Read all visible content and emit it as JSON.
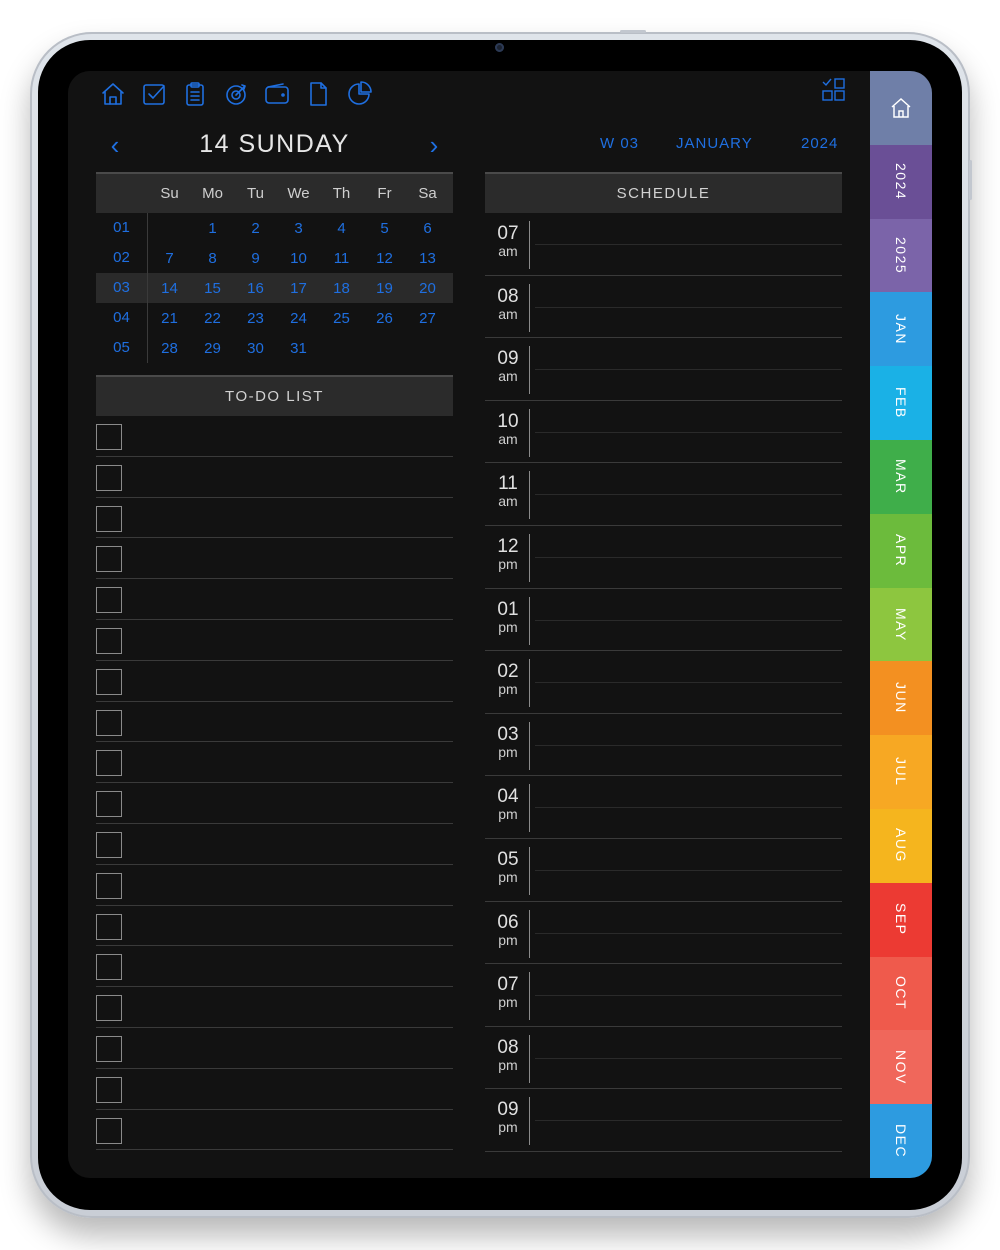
{
  "toolbar": {
    "icons": [
      "home-icon",
      "task-icon",
      "notes-icon",
      "goals-icon",
      "wallet-icon",
      "document-icon",
      "pie-chart-icon"
    ],
    "layout_icon": "layout-grid-icon"
  },
  "day_nav": {
    "prev_glyph": "‹",
    "next_glyph": "›",
    "title": "14 SUNDAY",
    "week": "W 03",
    "month": "JANUARY",
    "year": "2024"
  },
  "calendar": {
    "weekdays": [
      "Su",
      "Mo",
      "Tu",
      "We",
      "Th",
      "Fr",
      "Sa"
    ],
    "weeks": [
      {
        "num": "01",
        "days": [
          "",
          "1",
          "2",
          "3",
          "4",
          "5",
          "6"
        ]
      },
      {
        "num": "02",
        "days": [
          "7",
          "8",
          "9",
          "10",
          "11",
          "12",
          "13"
        ]
      },
      {
        "num": "03",
        "days": [
          "14",
          "15",
          "16",
          "17",
          "18",
          "19",
          "20"
        ]
      },
      {
        "num": "04",
        "days": [
          "21",
          "22",
          "23",
          "24",
          "25",
          "26",
          "27"
        ]
      },
      {
        "num": "05",
        "days": [
          "28",
          "29",
          "30",
          "31",
          "",
          "",
          ""
        ]
      }
    ],
    "current_week": "03"
  },
  "todo": {
    "heading": "TO-DO LIST",
    "item_count": 18
  },
  "schedule": {
    "heading": "SCHEDULE",
    "slots": [
      {
        "hour": "07",
        "ampm": "am"
      },
      {
        "hour": "08",
        "ampm": "am"
      },
      {
        "hour": "09",
        "ampm": "am"
      },
      {
        "hour": "10",
        "ampm": "am"
      },
      {
        "hour": "11",
        "ampm": "am"
      },
      {
        "hour": "12",
        "ampm": "pm"
      },
      {
        "hour": "01",
        "ampm": "pm"
      },
      {
        "hour": "02",
        "ampm": "pm"
      },
      {
        "hour": "03",
        "ampm": "pm"
      },
      {
        "hour": "04",
        "ampm": "pm"
      },
      {
        "hour": "05",
        "ampm": "pm"
      },
      {
        "hour": "06",
        "ampm": "pm"
      },
      {
        "hour": "07",
        "ampm": "pm"
      },
      {
        "hour": "08",
        "ampm": "pm"
      },
      {
        "hour": "09",
        "ampm": "pm"
      }
    ]
  },
  "side_tabs": [
    {
      "label": "",
      "icon": "home-icon",
      "color": "#6f7fa8"
    },
    {
      "label": "2024",
      "color": "#6a4f96"
    },
    {
      "label": "2025",
      "color": "#7b64a9"
    },
    {
      "label": "JAN",
      "color": "#2d9be0"
    },
    {
      "label": "FEB",
      "color": "#1ab1e6"
    },
    {
      "label": "MAR",
      "color": "#3fae4a"
    },
    {
      "label": "APR",
      "color": "#6cbb3c"
    },
    {
      "label": "MAY",
      "color": "#8dc63f"
    },
    {
      "label": "JUN",
      "color": "#f39021"
    },
    {
      "label": "JUL",
      "color": "#f7a823"
    },
    {
      "label": "AUG",
      "color": "#f5b51e"
    },
    {
      "label": "SEP",
      "color": "#ec3a33"
    },
    {
      "label": "OCT",
      "color": "#ef5a4c"
    },
    {
      "label": "NOV",
      "color": "#f0675b"
    },
    {
      "label": "DEC",
      "color": "#2d9be0"
    }
  ],
  "accent_color": "#1f6fe0"
}
